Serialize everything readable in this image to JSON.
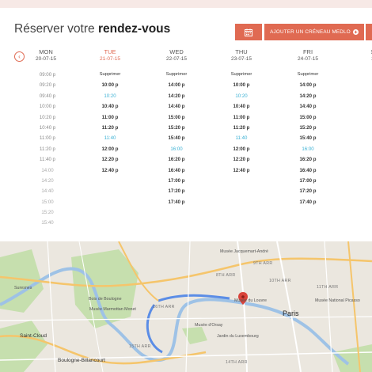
{
  "header": {
    "title_prefix": "Réserver votre",
    "title_bold": "rendez-vous",
    "calendar_icon": "calendar-icon",
    "add_label": "AJOUTER UN CRÉNEAU MEDLO",
    "add_icon": "plus-circle-icon",
    "accent_color": "#e06a52"
  },
  "nav": {
    "prev_icon": "chevron-left-icon"
  },
  "times": [
    "09:00 p",
    "09:20 p",
    "09:40 p",
    "10:00 p",
    "10:20 p",
    "10:40 p",
    "11:00 p",
    "11:20 p",
    "11:40 p",
    "14:00",
    "14:20",
    "14:40",
    "15:00",
    "15:20",
    "15:40"
  ],
  "days": [
    {
      "name": "MON",
      "date": "20-07-15",
      "today": false,
      "slots": []
    },
    {
      "name": "TUE",
      "date": "21-07-15",
      "today": true,
      "slots": [
        {
          "text": "Supprimer",
          "kind": "label"
        },
        {
          "text": "10:00 p",
          "kind": "bold"
        },
        {
          "text": "10:20",
          "kind": "link"
        },
        {
          "text": "10:40 p",
          "kind": "bold"
        },
        {
          "text": "11:00 p",
          "kind": "bold"
        },
        {
          "text": "11:20 p",
          "kind": "bold"
        },
        {
          "text": "11:40",
          "kind": "link"
        },
        {
          "text": "12:00 p",
          "kind": "bold"
        },
        {
          "text": "12:20 p",
          "kind": "bold"
        },
        {
          "text": "12:40 p",
          "kind": "bold"
        }
      ]
    },
    {
      "name": "WED",
      "date": "22-07-15",
      "today": false,
      "slots": [
        {
          "text": "Supprimer",
          "kind": "label"
        },
        {
          "text": "14:00 p",
          "kind": "bold"
        },
        {
          "text": "14:20 p",
          "kind": "bold"
        },
        {
          "text": "14:40 p",
          "kind": "bold"
        },
        {
          "text": "15:00 p",
          "kind": "bold"
        },
        {
          "text": "15:20 p",
          "kind": "bold"
        },
        {
          "text": "15:40 p",
          "kind": "bold"
        },
        {
          "text": "16:00",
          "kind": "link"
        },
        {
          "text": "16:20 p",
          "kind": "bold"
        },
        {
          "text": "16:40 p",
          "kind": "bold"
        },
        {
          "text": "17:00 p",
          "kind": "bold"
        },
        {
          "text": "17:20 p",
          "kind": "bold"
        },
        {
          "text": "17:40 p",
          "kind": "bold"
        }
      ]
    },
    {
      "name": "THU",
      "date": "23-07-15",
      "today": false,
      "slots": [
        {
          "text": "Supprimer",
          "kind": "label"
        },
        {
          "text": "10:00 p",
          "kind": "bold"
        },
        {
          "text": "10:20",
          "kind": "link"
        },
        {
          "text": "10:40 p",
          "kind": "bold"
        },
        {
          "text": "11:00 p",
          "kind": "bold"
        },
        {
          "text": "11:20 p",
          "kind": "bold"
        },
        {
          "text": "11:40",
          "kind": "link"
        },
        {
          "text": "12:00 p",
          "kind": "bold"
        },
        {
          "text": "12:20 p",
          "kind": "bold"
        },
        {
          "text": "12:40 p",
          "kind": "bold"
        }
      ]
    },
    {
      "name": "FRI",
      "date": "24-07-15",
      "today": false,
      "slots": [
        {
          "text": "Supprimer",
          "kind": "label"
        },
        {
          "text": "14:00 p",
          "kind": "bold"
        },
        {
          "text": "14:20 p",
          "kind": "bold"
        },
        {
          "text": "14:40 p",
          "kind": "bold"
        },
        {
          "text": "15:00 p",
          "kind": "bold"
        },
        {
          "text": "15:20 p",
          "kind": "bold"
        },
        {
          "text": "15:40 p",
          "kind": "bold"
        },
        {
          "text": "16:00",
          "kind": "link"
        },
        {
          "text": "16:20 p",
          "kind": "bold"
        },
        {
          "text": "16:40 p",
          "kind": "bold"
        },
        {
          "text": "17:00 p",
          "kind": "bold"
        },
        {
          "text": "17:20 p",
          "kind": "bold"
        },
        {
          "text": "17:40 p",
          "kind": "bold"
        }
      ]
    },
    {
      "name": "S",
      "date": "2",
      "today": false,
      "slots": []
    }
  ],
  "map": {
    "labels": [
      {
        "text": "Paris",
        "style": "big"
      },
      {
        "text": "Boulogne-Billancourt",
        "style": "mid"
      },
      {
        "text": "Saint-Cloud",
        "style": "mid"
      },
      {
        "text": "Suresnes",
        "style": ""
      },
      {
        "text": "16TH ARR",
        "style": "arr"
      },
      {
        "text": "8TH ARR",
        "style": "arr"
      },
      {
        "text": "9TH ARR",
        "style": "arr"
      },
      {
        "text": "10TH ARR",
        "style": "arr"
      },
      {
        "text": "11TH ARR",
        "style": "arr"
      },
      {
        "text": "15TH ARR",
        "style": "arr"
      },
      {
        "text": "14TH ARR",
        "style": "arr"
      },
      {
        "text": "Musée du Louvre",
        "style": ""
      },
      {
        "text": "Musée Jacquemart-André",
        "style": ""
      },
      {
        "text": "Musée National Picasso",
        "style": ""
      },
      {
        "text": "Bois de Boulogne",
        "style": ""
      },
      {
        "text": "Musée Marmottan Monet",
        "style": ""
      },
      {
        "text": "Jardin du Luxembourg",
        "style": ""
      },
      {
        "text": "Musée d'Orsay",
        "style": ""
      }
    ],
    "marker_icon": "map-pin-icon"
  }
}
